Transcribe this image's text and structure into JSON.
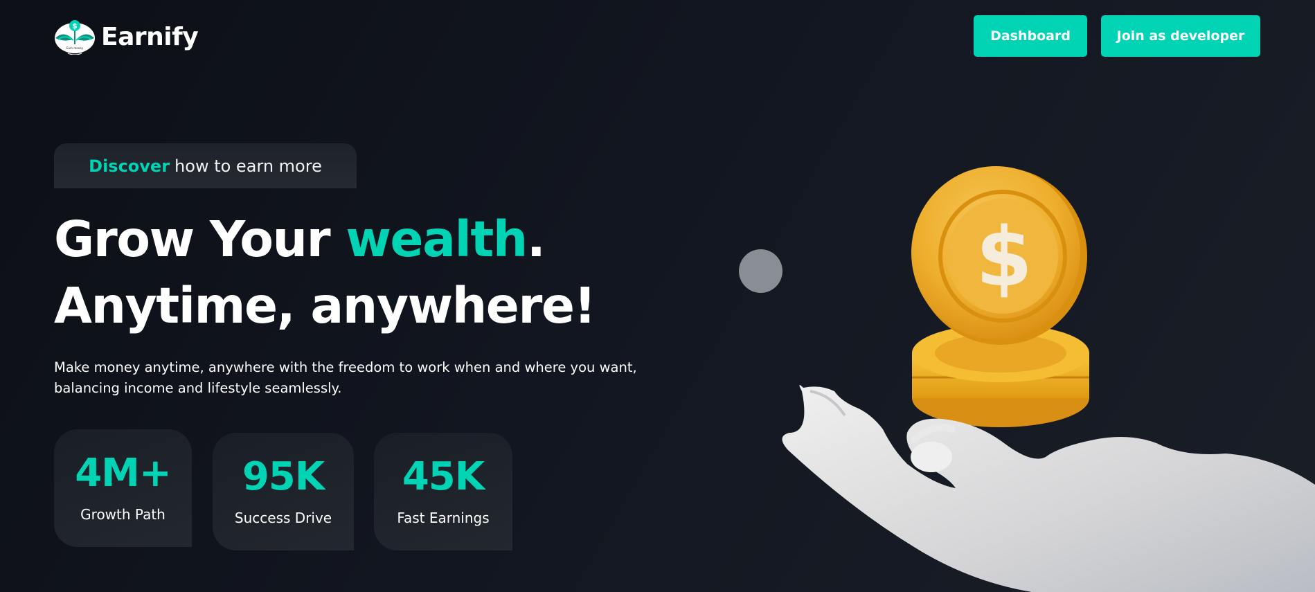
{
  "header": {
    "brand": "Earnify",
    "logo_tagline": "Earn money",
    "buttons": {
      "dashboard": "Dashboard",
      "join": "Join as developer"
    }
  },
  "hero": {
    "badge": {
      "accent": "Discover",
      "rest": "how to earn more"
    },
    "headline": {
      "line1_pre": "Grow Your ",
      "line1_accent": "wealth",
      "line1_post": ".",
      "line2": "Anytime, anywhere!"
    },
    "subtext_line1": "Make money anytime, anywhere with the freedom to work when and where you want,",
    "subtext_line2": "balancing income and lifestyle seamlessly."
  },
  "stats": [
    {
      "value": "4M+",
      "label": "Growth Path"
    },
    {
      "value": "95K",
      "label": "Success Drive"
    },
    {
      "value": "45K",
      "label": "Fast Earnings"
    }
  ],
  "illustration": {
    "coin_symbol": "$"
  },
  "icons": {
    "logo": "plant-coin-logo-icon",
    "coin": "dollar-coin-icon",
    "hand": "open-hand-icon",
    "dot": "gray-circle-decoration"
  },
  "colors": {
    "accent": "#00d4b4",
    "background": "#10141b",
    "card": "#20242c",
    "coin_gold": "#f2b82c",
    "hand": "#dcdcdc"
  }
}
